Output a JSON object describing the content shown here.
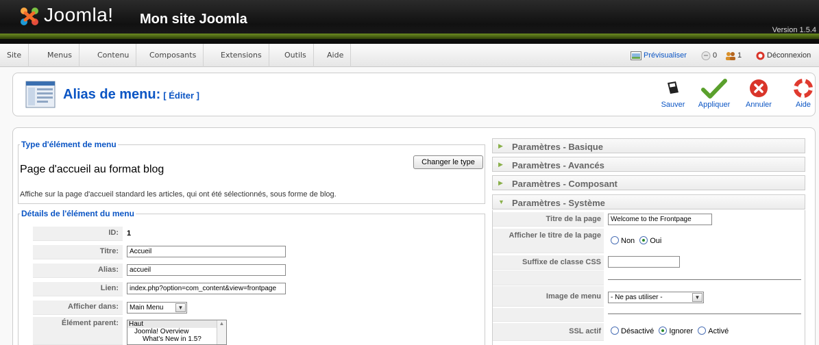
{
  "header": {
    "logo_text": "Joomla!",
    "site_name": "Mon site Joomla",
    "version": "Version 1.5.4"
  },
  "menubar": {
    "items": [
      "Site",
      "Menus",
      "Contenu",
      "Composants",
      "Extensions",
      "Outils",
      "Aide"
    ],
    "preview": "Prévisualiser",
    "messages_count": "0",
    "users_count": "1",
    "logout": "Déconnexion"
  },
  "toolbar": {
    "title": "Alias de menu:",
    "subtitle": "[ Éditer ]",
    "buttons": {
      "save": "Sauver",
      "apply": "Appliquer",
      "cancel": "Annuler",
      "help": "Aide"
    }
  },
  "type_section": {
    "legend": "Type d'élément de menu",
    "title": "Page d'accueil au format blog",
    "description": "Affiche sur la page d'accueil standard les articles, qui ont été sélectionnés, sous forme de blog.",
    "change_button": "Changer le type"
  },
  "details": {
    "legend": "Détails de l'élément du menu",
    "id_label": "ID:",
    "id_value": "1",
    "title_label": "Titre:",
    "title_value": "Accueil",
    "alias_label": "Alias:",
    "alias_value": "accueil",
    "link_label": "Lien:",
    "link_value": "index.php?option=com_content&view=frontpage",
    "display_label": "Afficher dans:",
    "display_value": "Main Menu",
    "parent_label": "Élément parent:",
    "parent_options": [
      "Haut",
      "Joomla! Overview",
      "What's New in 1.5?"
    ]
  },
  "params": {
    "basic": "Paramètres - Basique",
    "advanced": "Paramètres - Avancés",
    "component": "Paramètres - Composant",
    "system": "Paramètres - Système",
    "page_title_label": "Titre de la page",
    "page_title_value": "Welcome to the Frontpage",
    "show_title_label": "Afficher le titre de la page",
    "show_title_no": "Non",
    "show_title_yes": "Oui",
    "css_suffix_label": "Suffixe de classe CSS",
    "menu_image_label": "Image de menu",
    "menu_image_value": "- Ne pas utiliser -",
    "ssl_label": "SSL actif",
    "ssl_disabled": "Désactivé",
    "ssl_ignore": "Ignorer",
    "ssl_enabled": "Activé"
  },
  "colors": {
    "link_blue": "#0b55c4",
    "header_green": "#6c8d20"
  }
}
